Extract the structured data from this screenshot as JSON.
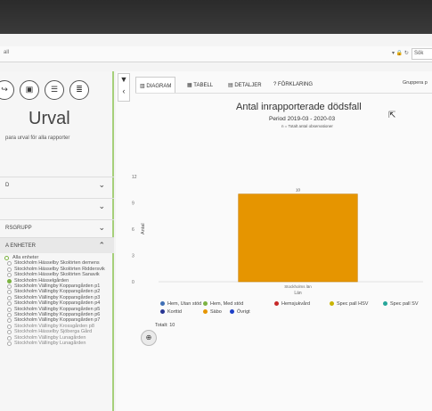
{
  "address_bar": {
    "url": "all",
    "tools": "▾ 🔒 ↻",
    "search": "Sök"
  },
  "toolbar": {
    "icons": [
      "share-icon",
      "save-icon",
      "list-icon",
      "delete-icon"
    ]
  },
  "sidebar": {
    "title": "Urval",
    "subtitle": "para urval för alla rapporter",
    "sections": [
      {
        "label": "D",
        "expanded": false
      },
      {
        "label": "",
        "expanded": false
      },
      {
        "label": "RSGRUPP",
        "expanded": false
      },
      {
        "label": "A ENHETER",
        "expanded": true
      }
    ],
    "tree": [
      "Alla enheter",
      "Stockholm Hässelby Skolörten demens",
      "Stockholm Hässelby Skolörten Riddersvik",
      "Stockholm Hässelby Skolörten Sanavik",
      "Stockholm Hässelgården",
      "Stockholm Vällingby Kopparsgården p1",
      "Stockholm Vällingby Kopparsgården p2",
      "Stockholm Vällingby Kopparsgården p3",
      "Stockholm Vällingby Kopparsgården p4",
      "Stockholm Vällingby Kopparsgården p5",
      "Stockholm Vällingby Kopparsgården p6",
      "Stockholm Vällingby Kopparsgården p7",
      "Stockholm Vällingby Krossgården p8",
      "Stockholm Hässelby Sjöberga Gård",
      "Stockholm Vällingby Lunagården",
      "Stockholm Vällingby Lunagården"
    ]
  },
  "main": {
    "tabs": [
      "DIAGRAM",
      "TABELL",
      "DETALJER",
      "FÖRKLARING"
    ],
    "gruppera": "Gruppera p",
    "total_label": "Totalt: 10"
  },
  "chart_data": {
    "type": "bar",
    "title": "Antal inrapporterade dödsfall",
    "subtitle": "Period 2019-03 - 2020-03",
    "note": "n = Totalt antal observationer",
    "categories": [
      "Stockholms län"
    ],
    "values": [
      10
    ],
    "data_labels": [
      "10"
    ],
    "xlabel": "Län",
    "ylabel": "Antal",
    "ylim": [
      0,
      12
    ],
    "yticks": [
      0,
      3,
      6,
      9,
      12
    ],
    "bar_color": "#e69500",
    "grid": false,
    "legend_position": "bottom",
    "legend": [
      {
        "label": "Hem, Utan stöd",
        "color": "#3f6fb5"
      },
      {
        "label": "Hem, Med stöd",
        "color": "#7cb342"
      },
      {
        "label": "Hemsjukvård",
        "color": "#c62828"
      },
      {
        "label": "Spec pall HSV",
        "color": "#c9b400"
      },
      {
        "label": "Spec pall SV",
        "color": "#26a69a"
      },
      {
        "label": "Korttid",
        "color": "#283593"
      },
      {
        "label": "Säbo",
        "color": "#e69500"
      },
      {
        "label": "Övrigt",
        "color": "#1e40c8"
      }
    ]
  }
}
